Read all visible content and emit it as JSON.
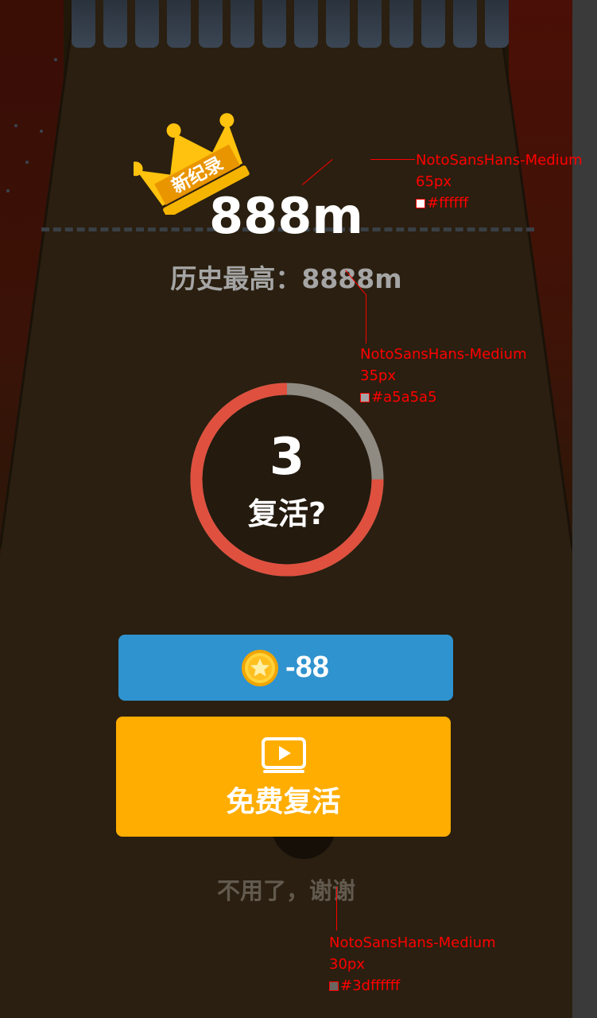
{
  "result": {
    "record_badge": "新纪录",
    "distance": "888m",
    "best": "历史最高：8888m"
  },
  "revive": {
    "countdown": "3",
    "prompt": "复活?",
    "countdown_progress": 0.75,
    "ring_active_color": "#e0503f",
    "ring_track_color": "#8f8a82"
  },
  "buttons": {
    "coin_revive_label": "-88",
    "coin_icon": "gold-star-coin-icon",
    "free_revive_label": "免费复活",
    "video_icon": "video-play-icon",
    "no_thanks_label": "不用了，谢谢"
  },
  "colors": {
    "coin_button": "#2f93cf",
    "free_button": "#ffad00",
    "crown": "#ffc20e"
  },
  "annotations": [
    {
      "font": "NotoSansHans-Medium",
      "size": "65px",
      "color": "#ffffff"
    },
    {
      "font": "NotoSansHans-Medium",
      "size": "35px",
      "color": "#a5a5a5"
    },
    {
      "font": "NotoSansHans-Medium",
      "size": "30px",
      "color": "#3dffffff"
    }
  ]
}
